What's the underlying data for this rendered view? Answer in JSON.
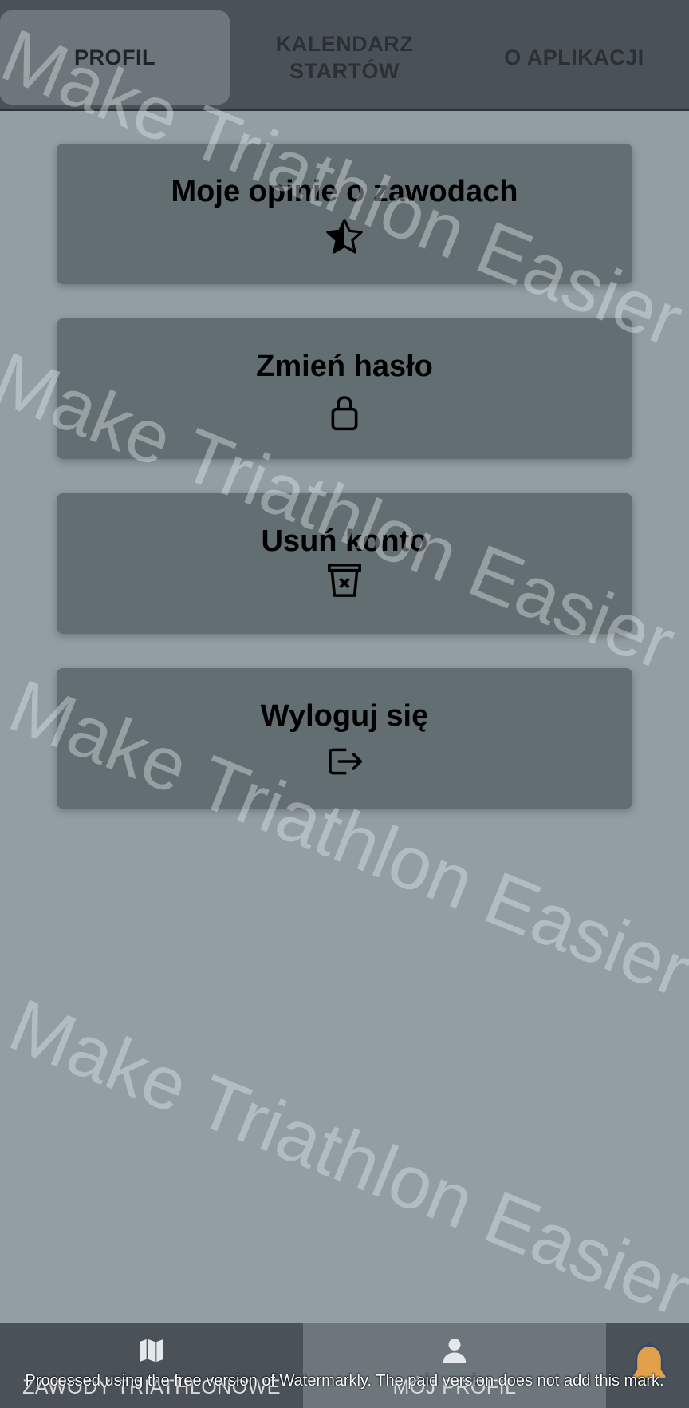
{
  "tabs": [
    {
      "label": "PROFIL"
    },
    {
      "label": "KALENDARZ STARTÓW"
    },
    {
      "label": "O APLIKACJI"
    }
  ],
  "menu": [
    {
      "label": "Moje opinie o zawodach",
      "icon": "star-half-icon"
    },
    {
      "label": "Zmień hasło",
      "icon": "lock-icon"
    },
    {
      "label": "Usuń konto",
      "icon": "trash-icon"
    },
    {
      "label": "Wyloguj się",
      "icon": "logout-icon"
    }
  ],
  "bottom_nav": [
    {
      "label": "ZAWODY TRIATHLONOWE",
      "icon": "map-icon"
    },
    {
      "label": "MÓJ PROFIL",
      "icon": "user-icon"
    }
  ],
  "notification_icon": "bell-icon",
  "watermark": {
    "text": "Make Triathlon Easier",
    "footer": "Processed using the free version of Watermarkly. The paid version does not add this mark."
  },
  "colors": {
    "background": "#929ea3",
    "bar": "#4a5258",
    "active_tab": "#6c767b",
    "card": "#636e72",
    "bell": "#e2a04a"
  }
}
